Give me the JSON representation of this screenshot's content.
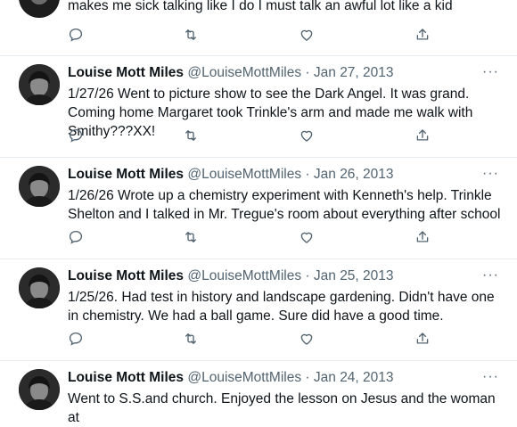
{
  "top_tweet": {
    "text": "makes me sick talking like I do I must talk an awful lot like a kid"
  },
  "tweets": [
    {
      "name": "Louise Mott Miles",
      "handle": "@LouiseMottMiles",
      "date": "Jan 27, 2013",
      "text": "1/27/26 Went to picture show to see the Dark Angel. It was grand. Coming home Margaret took Trinkle's arm and made me walk with Smithy???XX!"
    },
    {
      "name": "Louise Mott Miles",
      "handle": "@LouiseMottMiles",
      "date": "Jan 26, 2013",
      "text": "1/26/26 Wrote up a chemistry experiment with Kenneth's help. Trinkle Shelton and I talked in Mr. Tregue's room about everything after school"
    },
    {
      "name": "Louise Mott Miles",
      "handle": "@LouiseMottMiles",
      "date": "Jan 25, 2013",
      "text": "1/25/26. Had test in history and landscape gardening. Didn't have one in chemistry. We had a ball game. Sure did have a good time."
    },
    {
      "name": "Louise Mott Miles",
      "handle": "@LouiseMottMiles",
      "date": "Jan 24, 2013",
      "text": "Went to S.S.and church. Enjoyed the lesson on Jesus and the woman at"
    }
  ],
  "separator": "·",
  "more_label": "···",
  "icons": [
    "reply-icon",
    "retweet-icon",
    "like-icon",
    "share-icon"
  ],
  "colors": {
    "text": "#0f1419",
    "muted": "#536471",
    "border": "#e6ecf0"
  }
}
